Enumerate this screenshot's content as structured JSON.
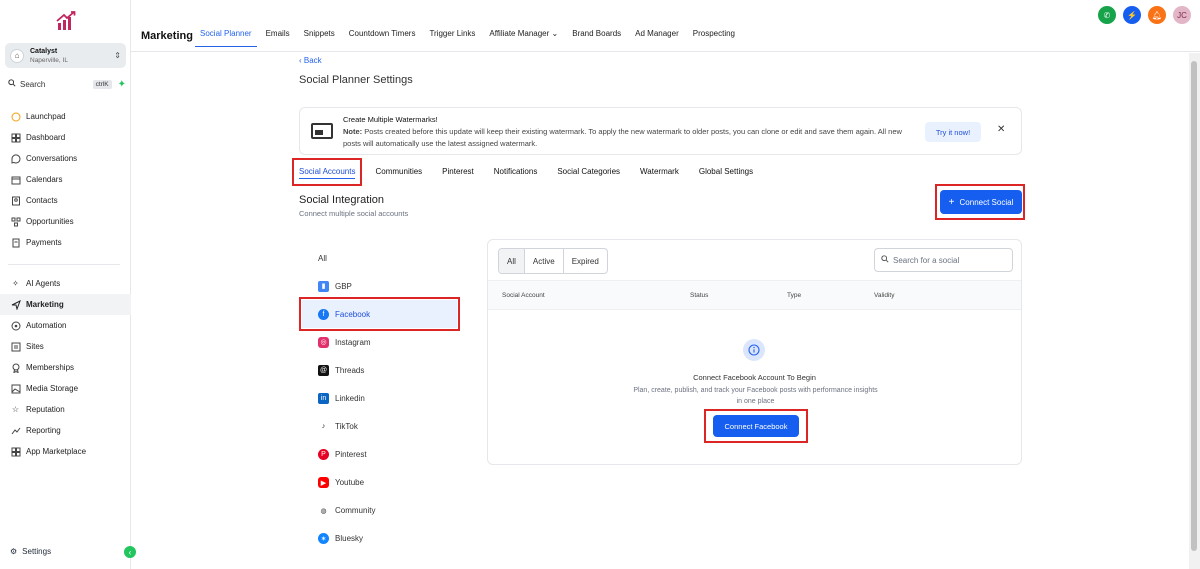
{
  "account": {
    "name": "Catalyst",
    "location": "Naperville, IL"
  },
  "search": {
    "label": "Search",
    "shortcut": "ctrlK"
  },
  "nav": {
    "primary": [
      "Launchpad",
      "Dashboard",
      "Conversations",
      "Calendars",
      "Contacts",
      "Opportunities",
      "Payments"
    ],
    "secondary": [
      "AI Agents",
      "Marketing",
      "Automation",
      "Sites",
      "Memberships",
      "Media Storage",
      "Reputation",
      "Reporting",
      "App Marketplace"
    ],
    "settings": "Settings"
  },
  "topbar": {
    "section": "Marketing",
    "tabs": [
      "Social Planner",
      "Emails",
      "Snippets",
      "Countdown Timers",
      "Trigger Links",
      "Affiliate Manager",
      "Brand Boards",
      "Ad Manager",
      "Prospecting"
    ],
    "avatar_initials": "JC",
    "colors": {
      "phone": "#16a34a",
      "bolt": "#155eef",
      "bell": "#f97316",
      "avatar": "#e2b6c6"
    }
  },
  "page": {
    "back": "Back",
    "title": "Social Planner Settings",
    "banner": {
      "title": "Create Multiple Watermarks!",
      "note_label": "Note:",
      "note_text": " Posts created before this update will keep their existing watermark. To apply the new watermark to older posts, you can clone or edit and save them again. All new posts will automatically use the latest assigned watermark.",
      "cta": "Try it now!"
    },
    "tabs": [
      "Social Accounts",
      "Communities",
      "Pinterest",
      "Notifications",
      "Social Categories",
      "Watermark",
      "Global Settings"
    ],
    "integration_title": "Social Integration",
    "integration_sub": "Connect multiple social accounts",
    "connect_social": "Connect Social"
  },
  "platforms": [
    "All",
    "GBP",
    "Facebook",
    "Instagram",
    "Threads",
    "Linkedin",
    "TikTok",
    "Pinterest",
    "Youtube",
    "Community",
    "Bluesky"
  ],
  "panel": {
    "filters": [
      "All",
      "Active",
      "Expired"
    ],
    "search_placeholder": "Search for a social",
    "columns": [
      "Social Account",
      "Status",
      "Type",
      "Validity"
    ],
    "empty_title": "Connect Facebook Account To Begin",
    "empty_desc": "Plan, create, publish, and track your Facebook posts with performance insights in one place",
    "cta": "Connect Facebook"
  }
}
